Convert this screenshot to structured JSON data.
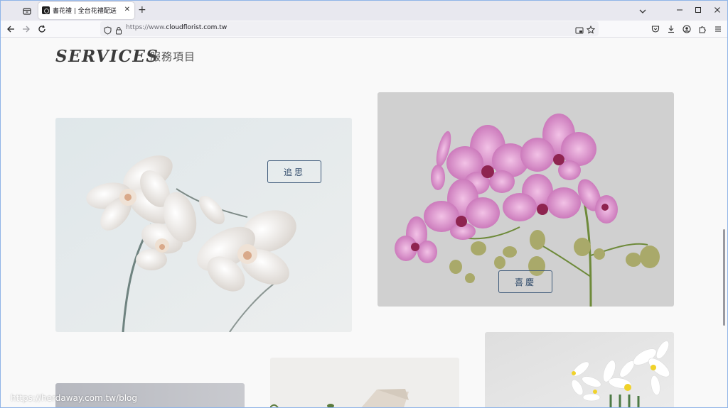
{
  "browser": {
    "tab": {
      "title": "書花禮 | 全台花禮配送",
      "close": "✕"
    },
    "new_tab": "+",
    "url": {
      "prefix": "https://www.",
      "domain": "cloudflorist.com.tw"
    },
    "status_url": "https://herdaway.com.tw/blog"
  },
  "page": {
    "section_title": "SERVICES",
    "section_subtitle": "服務項目",
    "cards": [
      {
        "label": "追思",
        "image": "white-orchid-photo"
      },
      {
        "label": "喜慶",
        "image": "pink-orchid-photo"
      },
      {
        "image": "grey-card-photo"
      },
      {
        "image": "cream-wrapped-bouquet-photo"
      },
      {
        "image": "white-daffodil-photo"
      }
    ]
  },
  "colors": {
    "accent": "#3e5a7a",
    "tabstrip": "#e8e8ef",
    "window_border": "#8fb4e8"
  }
}
